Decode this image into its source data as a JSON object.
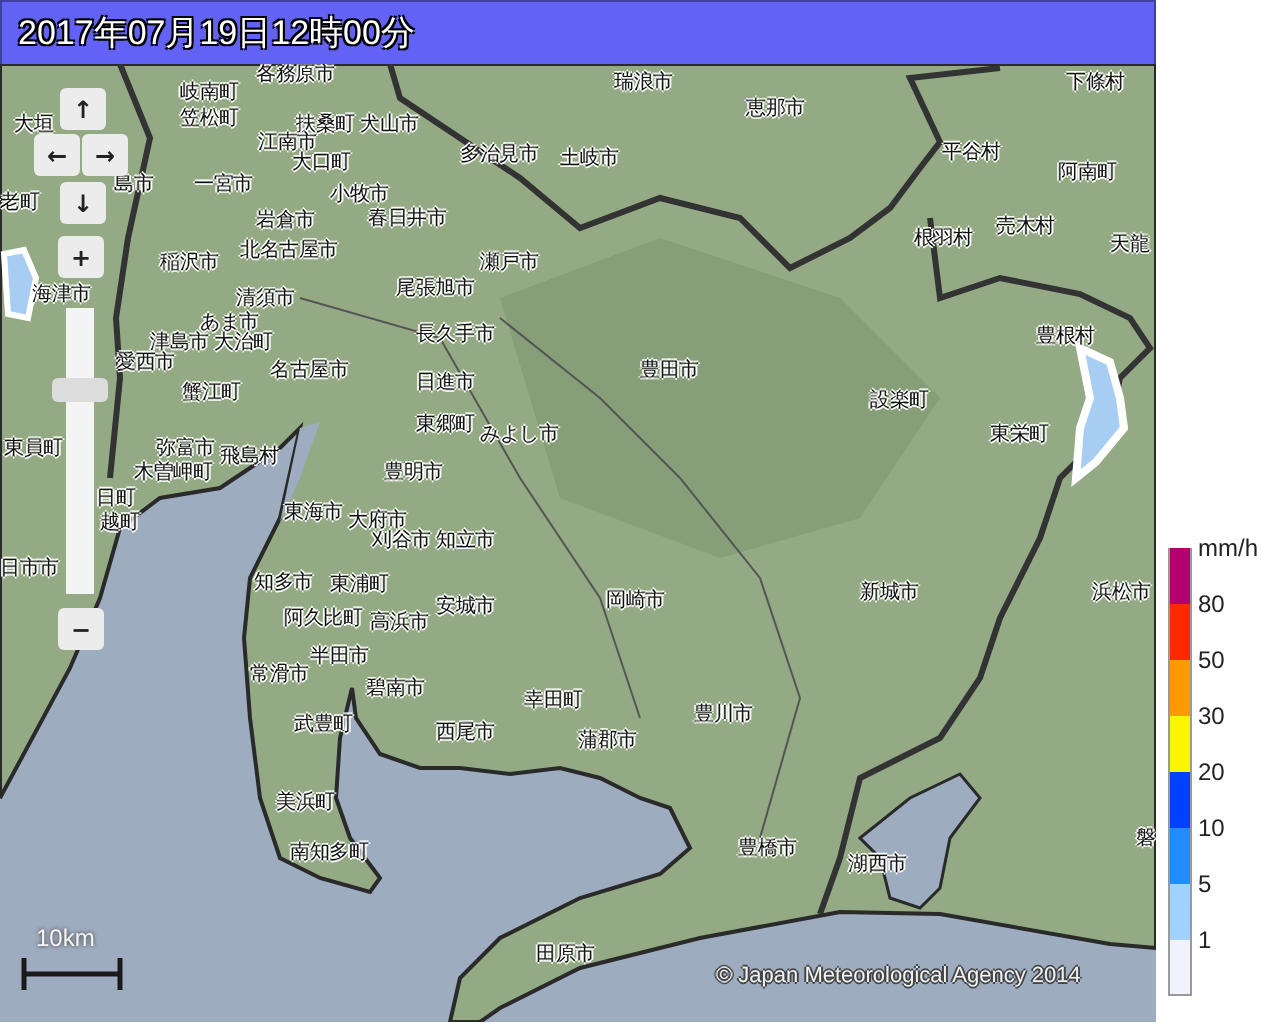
{
  "title": "2017年07月19日12時00分",
  "map": {
    "labels": [
      "岐南町",
      "各務原市",
      "瑞浪市",
      "下條村",
      "大垣",
      "笠松町",
      "扶桑町",
      "犬山市",
      "恵那市",
      "江南市",
      "大口町",
      "多治見市",
      "土岐市",
      "平谷村",
      "阿南町",
      "老町",
      "島市",
      "一宮市",
      "小牧市",
      "岩倉市",
      "春日井市",
      "根羽村",
      "売木村",
      "天龍",
      "稲沢市",
      "北名古屋市",
      "瀬戸市",
      "海津市",
      "清須市",
      "尾張旭市",
      "あま市",
      "津島市",
      "大治町",
      "長久手市",
      "豊根村",
      "愛西市",
      "名古屋市",
      "日進市",
      "豊田市",
      "蟹江町",
      "設楽町",
      "東郷町",
      "みよし市",
      "東栄町",
      "東員町",
      "弥富市",
      "飛島村",
      "木曽岬町",
      "豊明市",
      "日町",
      "越町",
      "東海市",
      "大府市",
      "刈谷市",
      "知立市",
      "日市市",
      "知多市",
      "東浦町",
      "安城市",
      "岡崎市",
      "新城市",
      "浜松市",
      "阿久比町",
      "高浜市",
      "半田市",
      "常滑市",
      "碧南市",
      "幸田町",
      "豊川市",
      "武豊町",
      "西尾市",
      "蒲郡市",
      "美浜町",
      "南知多町",
      "豊橋市",
      "湖西市",
      "磐",
      "田原市"
    ],
    "scale_bar": "10km",
    "copyright": "© Japan Meteorological Agency 2014"
  },
  "controls": {
    "pan_buttons": [
      "↑",
      "←",
      "→",
      "↓"
    ],
    "zoom_in": "+",
    "zoom_out": "−",
    "zoom_slider": {
      "level": 0.73
    }
  },
  "legend": {
    "levels": [
      {
        "label": "mm/h",
        "color": "#b4006e"
      },
      {
        "label": "80",
        "color": "#ff2800"
      },
      {
        "label": "50",
        "color": "#ff9900"
      },
      {
        "label": "30",
        "color": "#faf500"
      },
      {
        "label": "20",
        "color": "#0041ff"
      },
      {
        "label": "10",
        "color": "#218cff"
      },
      {
        "label": "5",
        "color": "#a0d2ff"
      },
      {
        "label": "1",
        "color": "#f2f2ff"
      }
    ]
  }
}
